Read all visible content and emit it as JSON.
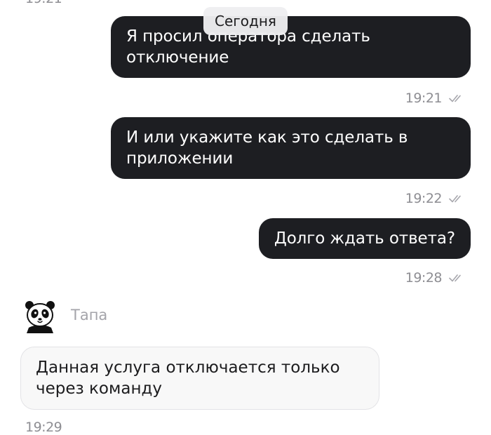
{
  "chat": {
    "date_chip": "Сегодня",
    "cut_off_time": "19:21",
    "messages": [
      {
        "direction": "out",
        "text": "Я просил оператора сделать отключение",
        "time": "19:21",
        "status_icon": "double-check-icon"
      },
      {
        "direction": "out",
        "text": "И или укажите как это сделать в приложении",
        "time": "19:22",
        "status_icon": "double-check-icon"
      },
      {
        "direction": "out",
        "text": "Долго ждать ответа?",
        "time": "19:28",
        "status_icon": "double-check-icon"
      },
      {
        "direction": "in",
        "sender": "Тапа",
        "avatar_icon": "panda-avatar-icon",
        "text": "Данная услуга отключается только через команду",
        "time": "19:29"
      }
    ]
  }
}
